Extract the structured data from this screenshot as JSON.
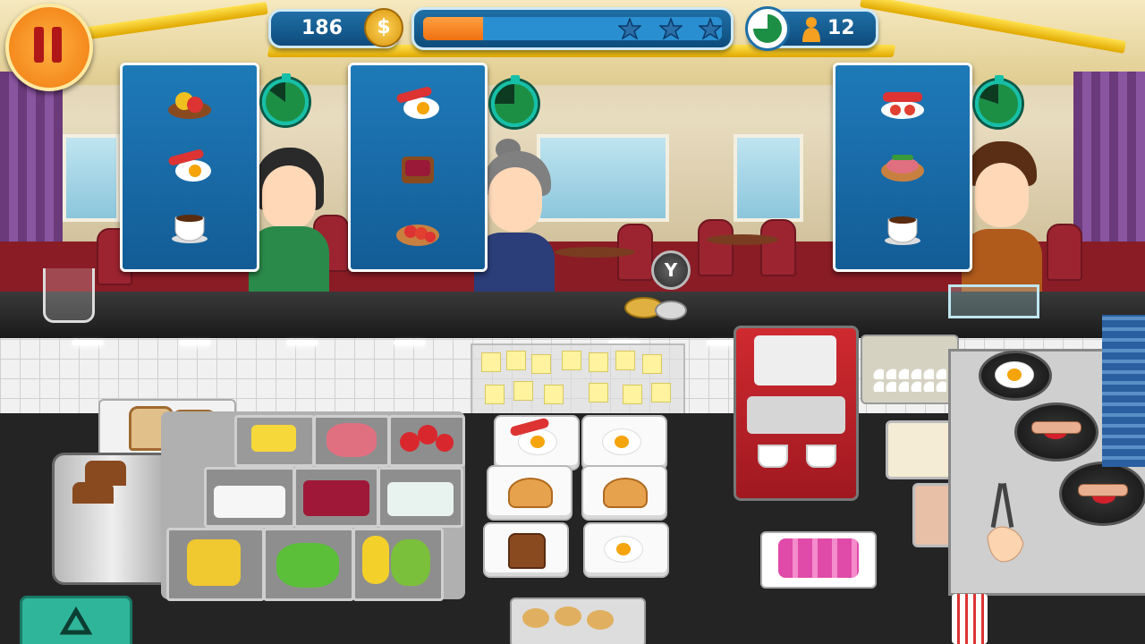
{
  "hud": {
    "pause_button_icon": "pause-icon",
    "coins": "186",
    "coin_icon": "dollar-coin-icon",
    "level_progress": 0.2,
    "stars": [
      "star-icon",
      "star-icon",
      "star-icon"
    ],
    "clock_icon": "clock-icon",
    "customers_left_icon": "person-icon",
    "customers_left": "12"
  },
  "prompt": {
    "button_hint": "Y"
  },
  "customers": [
    {
      "order_items": [
        "pepper-tomato-dish-icon",
        "sausage-egg-dish-icon",
        "coffee-cup-icon"
      ],
      "timer_fraction": 0.85
    },
    {
      "order_items": [
        "sausage-egg-dish-icon",
        "beet-toast-icon",
        "tomato-salami-toast-icon"
      ],
      "timer_fraction": 0.75
    },
    {
      "order_items": [
        "sausage-tomato-dish-icon",
        "ham-toast-icon",
        "coffee-cup-icon"
      ],
      "timer_fraction": 0.8
    }
  ],
  "colors": {
    "hud_blue": "#135c96",
    "progress_orange": "#f58a1f",
    "pause_orange": "#f07a10",
    "card_blue": "#1e7ab8",
    "timer_green": "#1d8f45"
  }
}
